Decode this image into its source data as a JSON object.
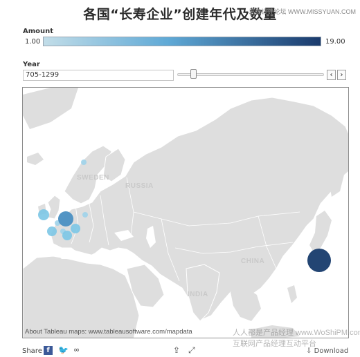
{
  "header": {
    "title": "各国“长寿企业”创建年代及数量",
    "watermark": "思缘设计论坛 WWW.MISSYUAN.COM"
  },
  "legend": {
    "label": "Amount",
    "min": "1.00",
    "max": "19.00",
    "color_low": "#c2dde8",
    "color_high": "#1a3a6c"
  },
  "year_filter": {
    "label": "Year",
    "value": "705-1299",
    "prev_label": "‹",
    "next_label": "›",
    "position": 0.1
  },
  "map": {
    "credit": "About Tableau maps: www.tableausoftware.com/mapdata",
    "labels": {
      "sweden": "SWEDEN",
      "russia": "RUSSIA",
      "china": "CHINA",
      "india": "INDIA"
    }
  },
  "footer": {
    "share_label": "Share",
    "download_label": "Download",
    "watermark_line1": "人人都是产品经理 www.WoShiPM.com",
    "watermark_line2": "互联网产品经理互动平台"
  },
  "colors": {
    "land": "#dedede",
    "water": "#ffffff",
    "bubble_light": "#7cc6e6",
    "bubble_mid": "#4a8fc2",
    "bubble_dark": "#1c3f6e"
  }
}
